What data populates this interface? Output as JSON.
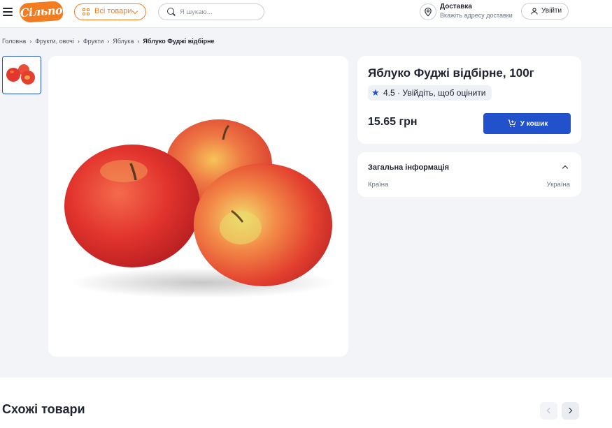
{
  "header": {
    "logo_text": "Сільпо",
    "all_goods_label": "Всі товари",
    "search_placeholder": "Я шукаю...",
    "delivery_title": "Доставка",
    "delivery_subtitle": "Вкажіть адресу доставки",
    "login_label": "Увійти"
  },
  "breadcrumb": [
    {
      "label": "Головна"
    },
    {
      "label": "Фрукти, овочі"
    },
    {
      "label": "Фрукти"
    },
    {
      "label": "Яблука"
    },
    {
      "label": "Яблуко Фуджі відбірне"
    }
  ],
  "product": {
    "title": "Яблуко Фуджі відбірне, 100г",
    "rating_value": "4.5",
    "rating_separator": "·",
    "rating_login_prompt": "Увійдіть, щоб оцінити",
    "price": "15.65 грн",
    "add_to_cart_label": "У кошик"
  },
  "info": {
    "section_title": "Загальна інформація",
    "rows": [
      {
        "key": "Країна",
        "value": "Україна"
      }
    ]
  },
  "similar": {
    "title": "Схожі товари"
  },
  "colors": {
    "brand_orange": "#f47c20",
    "accent_blue": "#2251cc",
    "page_bg": "#f2f4f7"
  },
  "icons": [
    "menu-icon",
    "grid-icon",
    "chevron-down-icon",
    "search-icon",
    "location-pin-icon",
    "user-icon",
    "star-icon",
    "cart-plus-icon",
    "chevron-up-icon",
    "chevron-left-icon",
    "chevron-right-icon"
  ]
}
